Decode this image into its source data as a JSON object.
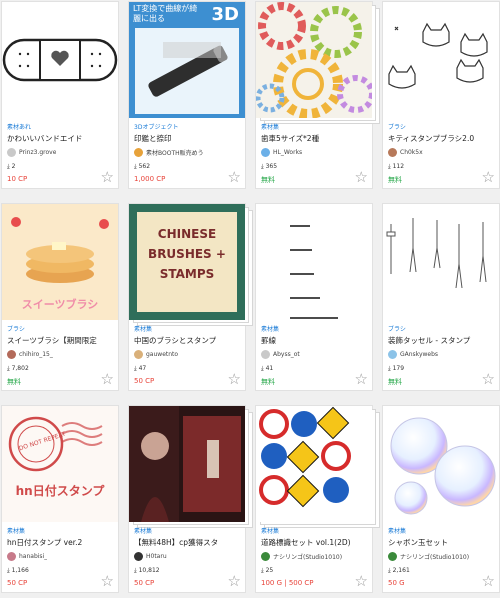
{
  "cards": [
    {
      "category": "素材あれ",
      "title": "かわいいバンドエイド",
      "author": "Prinz3.grove",
      "downloads": "2",
      "price": "10 CP",
      "price_type": "paid",
      "thumb": "bandage-icon"
    },
    {
      "category": "3Dオブジェクト",
      "title": "印鑑と捺印",
      "author": "素材BOOTH販売めう",
      "downloads": "562",
      "price": "1,000 CP",
      "price_type": "paid",
      "thumb": "stamp-3d",
      "banner_text": "LT変換で曲線が綺麗に出る",
      "badge": "3D"
    },
    {
      "category": "素材集",
      "title": "歯車5サイズ*2種",
      "author": "HL_Works",
      "downloads": "365",
      "price": "無料",
      "price_type": "free",
      "thumb": "gears"
    },
    {
      "category": "ブラシ",
      "title": "キティスタンプブラシ2.0",
      "author": "Ch0k5x",
      "downloads": "112",
      "price": "無料",
      "price_type": "free",
      "thumb": "cats"
    },
    {
      "category": "ブラシ",
      "title": "スイーツブラシ【期間限定",
      "author": "chihiro_15_",
      "downloads": "7,802",
      "price": "無料",
      "price_type": "free",
      "thumb": "pancakes",
      "thumb_text": "スイーツブラシ"
    },
    {
      "category": "素材集",
      "title": "中国のブラシとスタンプ",
      "author": "gauwetnto",
      "downloads": "47",
      "price": "50 CP",
      "price_type": "paid",
      "thumb": "chinese",
      "thumb_text": "CHINESE BRUSHES + STAMPS"
    },
    {
      "category": "素材集",
      "title": "罫線",
      "author": "Abyss_ot",
      "downloads": "41",
      "price": "無料",
      "price_type": "free",
      "thumb": "lines"
    },
    {
      "category": "ブラシ",
      "title": "装飾タッセル - スタンプ",
      "author": "GAnskywebs",
      "downloads": "179",
      "price": "無料",
      "price_type": "free",
      "thumb": "tassels"
    },
    {
      "category": "素材集",
      "title": "hn日付スタンプ ver.2",
      "author": "hanabisi_",
      "downloads": "1,166",
      "price": "50 CP",
      "price_type": "paid",
      "thumb": "date-stamp",
      "thumb_text": "hn日付スタンプ",
      "stamp_text": "DO NOT REPEAT"
    },
    {
      "category": "素材集",
      "title": "【無料48H】cp獲得スタ",
      "author": "H0taru",
      "downloads": "10,812",
      "price": "50 CP",
      "price_type": "paid",
      "thumb": "dark-art"
    },
    {
      "category": "素材集",
      "title": "道路標識セット vol.1(2D)",
      "author": "ナシリンゴ(Studio1010)",
      "downloads": "25",
      "price": "100 G | 500 CP",
      "price_type": "paid",
      "thumb": "road-signs"
    },
    {
      "category": "素材集",
      "title": "シャボン玉セット",
      "author": "ナシリンゴ(Studio1010)",
      "downloads": "2,161",
      "price": "50 G",
      "price_type": "paid",
      "thumb": "bubbles"
    }
  ],
  "icons": {
    "download": "download-icon",
    "favorite": "star-icon"
  },
  "colors": {
    "category": "#1a7bd6",
    "price_paid": "#e8443a",
    "price_free": "#27a84a",
    "star": "#9a9a9a"
  }
}
